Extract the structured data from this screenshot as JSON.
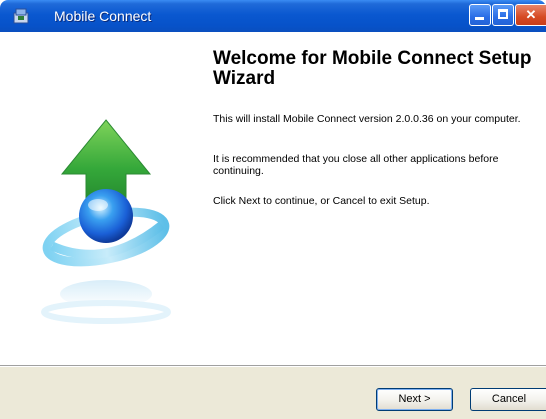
{
  "window": {
    "title": "Mobile Connect",
    "controls": {
      "minimize": "minimize-icon",
      "maximize": "maximize-icon",
      "close_glyph": "✕"
    }
  },
  "content": {
    "heading": "Welcome for Mobile Connect Setup Wizard",
    "paragraph_1": "This will install Mobile Connect version 2.0.0.36 on your computer.",
    "paragraph_2": "It is recommended that you close all other applications before continuing.",
    "paragraph_3": "Click Next to continue, or Cancel to exit Setup."
  },
  "buttons": {
    "next": "Next >",
    "cancel": "Cancel"
  },
  "colors": {
    "titlebar": "#0a58d0",
    "bottom_bar": "#ece9d8",
    "arrow_green": "#2e9c3a",
    "globe_blue": "#1a5fd6"
  }
}
